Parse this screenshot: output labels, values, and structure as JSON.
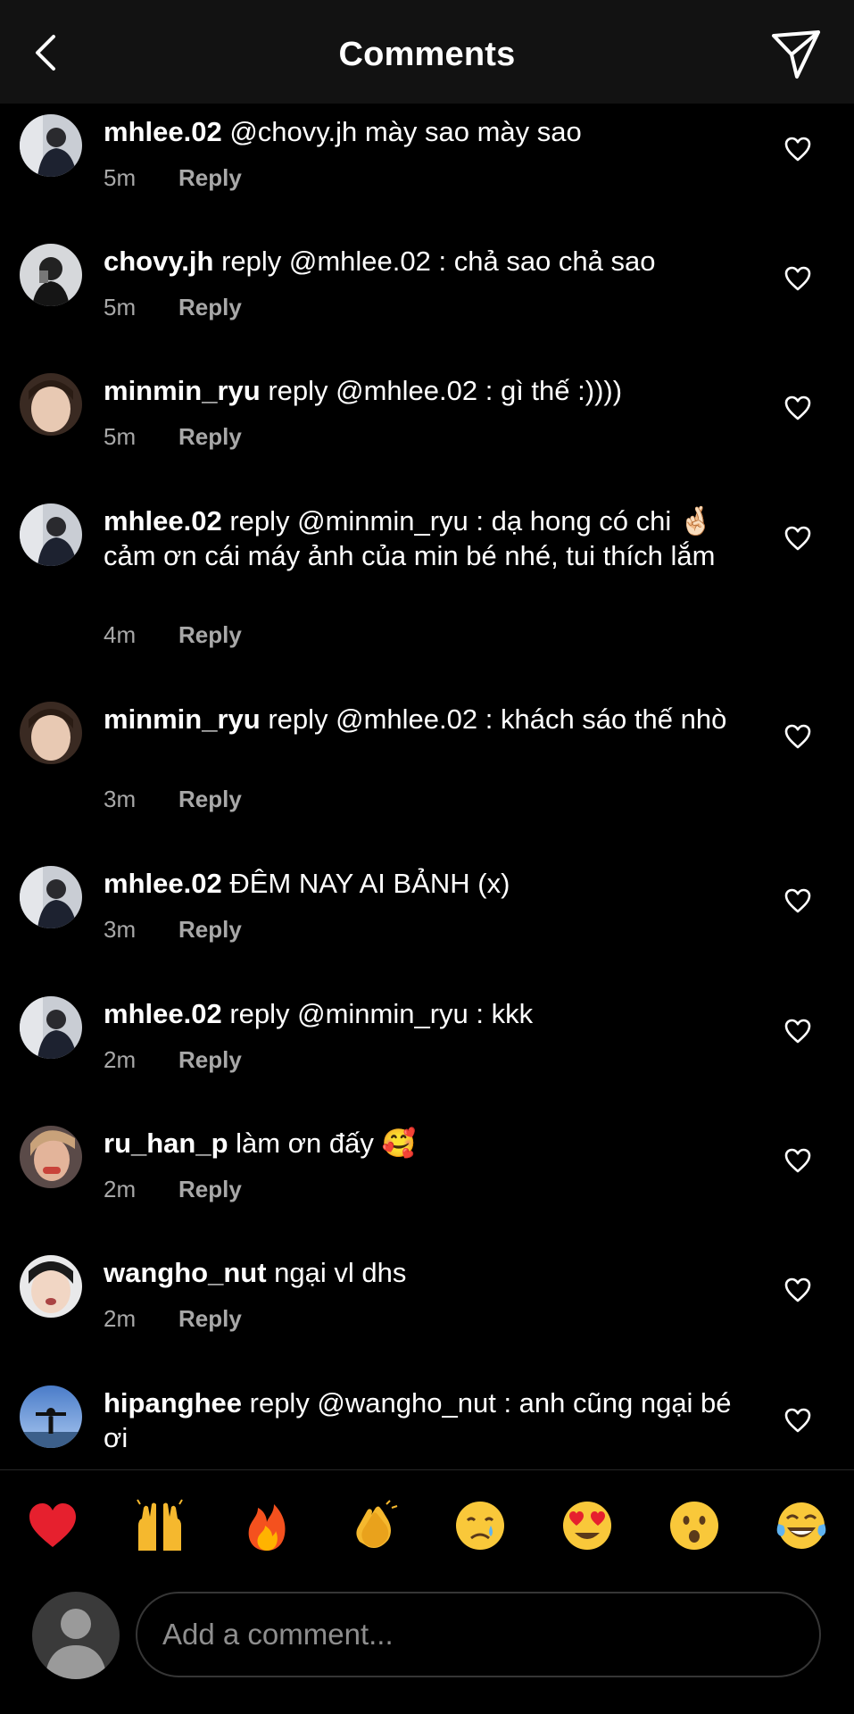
{
  "header": {
    "title": "Comments",
    "back_icon": "chevron-left-icon",
    "share_icon": "paper-plane-icon"
  },
  "comments": [
    {
      "username": "mhlee.02",
      "text": " @chovy.jh mày sao mày sao",
      "time": "5m",
      "reply_label": "Reply"
    },
    {
      "username": "chovy.jh",
      "text": " reply @mhlee.02 : chả sao chả sao",
      "time": "5m",
      "reply_label": "Reply"
    },
    {
      "username": "minmin_ryu",
      "text": " reply @mhlee.02 : gì thế :))))",
      "time": "5m",
      "reply_label": "Reply"
    },
    {
      "username": "mhlee.02",
      "text": " reply @minmin_ryu : dạ hong có chi 🤞🏻 cảm ơn cái máy ảnh của min bé nhé, tui thích lắm",
      "time": "4m",
      "reply_label": "Reply"
    },
    {
      "username": "minmin_ryu",
      "text": " reply @mhlee.02 : khách sáo thế nhò",
      "time": "3m",
      "reply_label": "Reply"
    },
    {
      "username": "mhlee.02",
      "text": " ĐÊM NAY AI BẢNH (x)",
      "time": "3m",
      "reply_label": "Reply"
    },
    {
      "username": "mhlee.02",
      "text": " reply @minmin_ryu : kkk",
      "time": "2m",
      "reply_label": "Reply"
    },
    {
      "username": "ru_han_p",
      "text": " làm ơn đấy 🥰",
      "time": "2m",
      "reply_label": "Reply"
    },
    {
      "username": "wangho_nut",
      "text": " ngại vl dhs",
      "time": "2m",
      "reply_label": "Reply"
    },
    {
      "username": "hipanghee",
      "text": " reply @wangho_nut : anh cũng ngại bé ơi",
      "time": "",
      "reply_label": ""
    }
  ],
  "like_icon": "heart-outline-icon",
  "reactions": [
    "red-heart",
    "raising-hands",
    "fire",
    "clapping-hands",
    "crying-face",
    "heart-eyes",
    "surprised-face",
    "tears-of-joy"
  ],
  "composer": {
    "placeholder": "Add a comment..."
  },
  "colors": {
    "background": "#000000",
    "header_bg": "#121212",
    "secondary_text": "#a8a8a8",
    "input_border": "#363636"
  }
}
